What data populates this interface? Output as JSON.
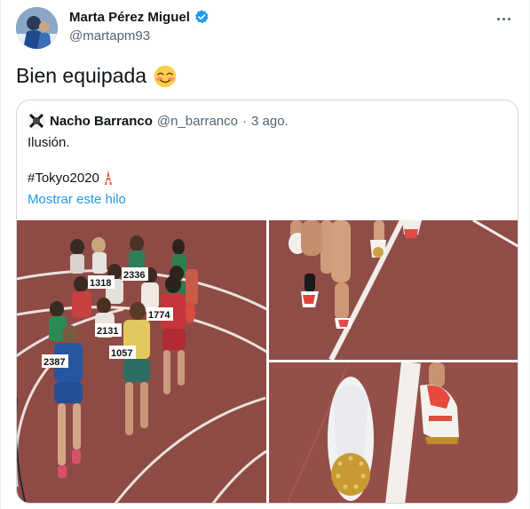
{
  "tweet": {
    "author_name": "Marta Pérez Miguel",
    "author_handle": "@martapm93",
    "text": "Bien equipada",
    "emoji": "smiling-face-emoji"
  },
  "quoted_tweet": {
    "author_name": "Nacho Barranco",
    "author_handle": "@n_barranco",
    "separator": "·",
    "date": "3 ago.",
    "line1": "Ilusión.",
    "hashtag": "#Tokyo2020",
    "link_text": "Mostrar este hilo",
    "bibs": [
      "2387",
      "1057",
      "1774",
      "2336",
      "2131",
      "1318"
    ]
  },
  "colors": {
    "text": "#0f1419",
    "secondary": "#536471",
    "link": "#1d9bf0",
    "border": "#cfd9de",
    "track": "#8c4a44"
  }
}
